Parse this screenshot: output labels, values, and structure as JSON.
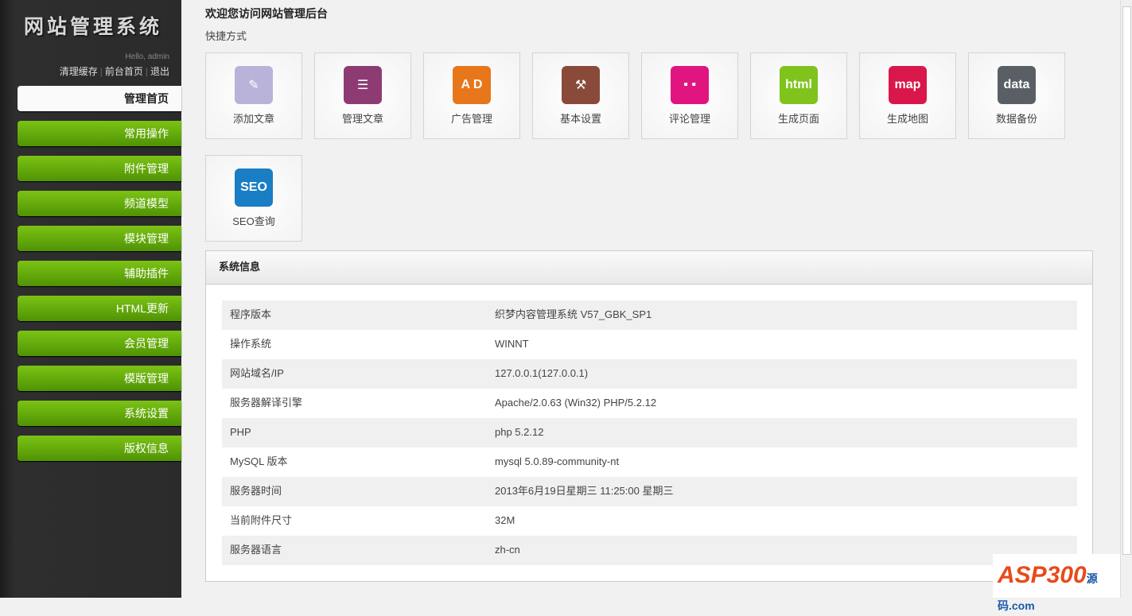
{
  "sidebar": {
    "logo": "网站管理系统",
    "hello": "Hello, admin",
    "links": [
      "清理缓存",
      "前台首页",
      "退出"
    ],
    "items": [
      "管理首页",
      "常用操作",
      "附件管理",
      "频道模型",
      "模块管理",
      "辅助插件",
      "HTML更新",
      "会员管理",
      "模版管理",
      "系统设置",
      "版权信息"
    ]
  },
  "main": {
    "title": "欢迎您访问网站管理后台",
    "shortcut_label": "快捷方式",
    "tiles": [
      {
        "label": "添加文章",
        "icon": "pencil-icon",
        "glyph": "✎",
        "color": "#b9b3d9"
      },
      {
        "label": "管理文章",
        "icon": "stack-icon",
        "glyph": "☰",
        "color": "#8e3b74"
      },
      {
        "label": "广告管理",
        "icon": "ad-icon",
        "glyph": "A D",
        "color": "#e8761b"
      },
      {
        "label": "基本设置",
        "icon": "hammer-icon",
        "glyph": "⚒",
        "color": "#8a4a3a"
      },
      {
        "label": "评论管理",
        "icon": "comment-icon",
        "glyph": "▪ ▪",
        "color": "#e0157f"
      },
      {
        "label": "生成页面",
        "icon": "html-icon",
        "glyph": "html",
        "color": "#7fc31c"
      },
      {
        "label": "生成地图",
        "icon": "map-icon",
        "glyph": "map",
        "color": "#d9174a"
      },
      {
        "label": "数据备份",
        "icon": "data-icon",
        "glyph": "data",
        "color": "#5a5f66"
      },
      {
        "label": "SEO查询",
        "icon": "seo-icon",
        "glyph": "SEO",
        "color": "#1a7ec5"
      }
    ]
  },
  "sysinfo": {
    "title": "系统信息",
    "rows": [
      [
        "程序版本",
        "织梦内容管理系统  V57_GBK_SP1"
      ],
      [
        "操作系统",
        "WINNT"
      ],
      [
        "网站域名/IP",
        "127.0.0.1(127.0.0.1)"
      ],
      [
        "服务器解译引擎",
        "Apache/2.0.63 (Win32) PHP/5.2.12"
      ],
      [
        "PHP",
        "php 5.2.12"
      ],
      [
        "MySQL 版本",
        "mysql 5.0.89-community-nt"
      ],
      [
        "服务器时间",
        "2013年6月19日星期三  11:25:00 星期三"
      ],
      [
        "当前附件尺寸",
        "32M"
      ],
      [
        "服务器语言",
        "zh-cn"
      ]
    ]
  },
  "watermark": {
    "text": "ASP300",
    "sub": "源码.com"
  }
}
